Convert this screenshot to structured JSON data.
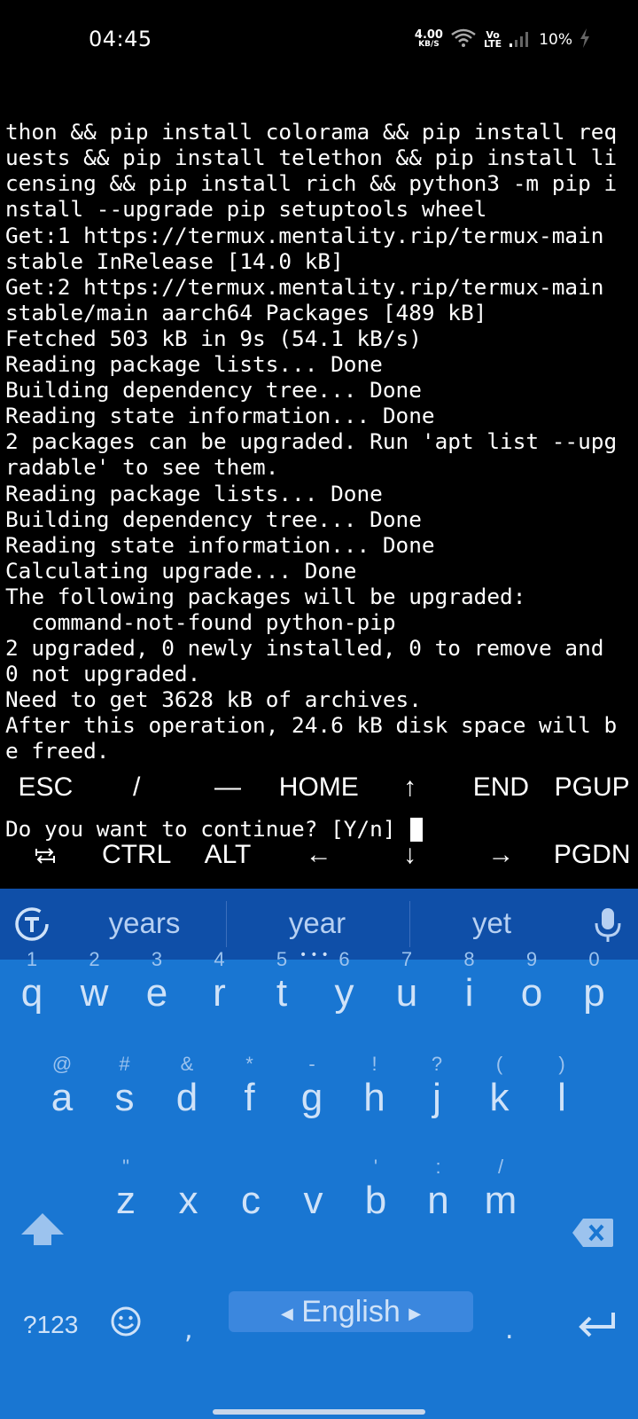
{
  "status_bar": {
    "time": "04:45",
    "net_speed_value": "4.00",
    "net_speed_unit": "KB/S",
    "volte_top": "Vo",
    "volte_bottom": "LTE",
    "battery": "10%"
  },
  "terminal": {
    "lines": [
      "thon && pip install colorama && pip install req",
      "uests && pip install telethon && pip install li",
      "censing && pip install rich && python3 -m pip i",
      "nstall --upgrade pip setuptools wheel",
      "Get:1 https://termux.mentality.rip/termux-main",
      "stable InRelease [14.0 kB]",
      "Get:2 https://termux.mentality.rip/termux-main",
      "stable/main aarch64 Packages [489 kB]",
      "Fetched 503 kB in 9s (54.1 kB/s)",
      "Reading package lists... Done",
      "Building dependency tree... Done",
      "Reading state information... Done",
      "2 packages can be upgraded. Run 'apt list --upg",
      "radable' to see them.",
      "Reading package lists... Done",
      "Building dependency tree... Done",
      "Reading state information... Done",
      "Calculating upgrade... Done",
      "The following packages will be upgraded:",
      "  command-not-found python-pip",
      "2 upgraded, 0 newly installed, 0 to remove and",
      "0 not upgraded.",
      "Need to get 3628 kB of archives.",
      "After this operation, 24.6 kB disk space will b",
      "e freed."
    ],
    "prompt": "Do you want to continue? [Y/n] "
  },
  "extra_keys": {
    "row1": [
      "ESC",
      "/",
      "—",
      "HOME",
      "↑",
      "END",
      "PGUP"
    ],
    "row2_icon": "tab-icon",
    "row2": [
      "CTRL",
      "ALT",
      "←",
      "↓",
      "→",
      "PGDN"
    ]
  },
  "keyboard": {
    "suggestions": [
      "years",
      "year",
      "yet"
    ],
    "row1": [
      {
        "hint": "1",
        "key": "q"
      },
      {
        "hint": "2",
        "key": "w"
      },
      {
        "hint": "3",
        "key": "e"
      },
      {
        "hint": "4",
        "key": "r"
      },
      {
        "hint": "5",
        "key": "t"
      },
      {
        "hint": "6",
        "key": "y"
      },
      {
        "hint": "7",
        "key": "u"
      },
      {
        "hint": "8",
        "key": "i"
      },
      {
        "hint": "9",
        "key": "o"
      },
      {
        "hint": "0",
        "key": "p"
      }
    ],
    "row2": [
      {
        "hint": "@",
        "key": "a"
      },
      {
        "hint": "#",
        "key": "s"
      },
      {
        "hint": "&",
        "key": "d"
      },
      {
        "hint": "*",
        "key": "f"
      },
      {
        "hint": "-",
        "key": "g"
      },
      {
        "hint": "!",
        "key": "h"
      },
      {
        "hint": "?",
        "key": "j"
      },
      {
        "hint": "(",
        "key": "k"
      },
      {
        "hint": ")",
        "key": "l"
      }
    ],
    "row3": [
      {
        "hint": "\"",
        "key": "z"
      },
      {
        "hint": "",
        "key": "x"
      },
      {
        "hint": "",
        "key": "c"
      },
      {
        "hint": "",
        "key": "v"
      },
      {
        "hint": "'",
        "key": "b"
      },
      {
        "hint": ":",
        "key": "n"
      },
      {
        "hint": "/",
        "key": "m"
      }
    ],
    "symbols_label": "?123",
    "comma": ",",
    "space_label": "English",
    "period": "."
  }
}
